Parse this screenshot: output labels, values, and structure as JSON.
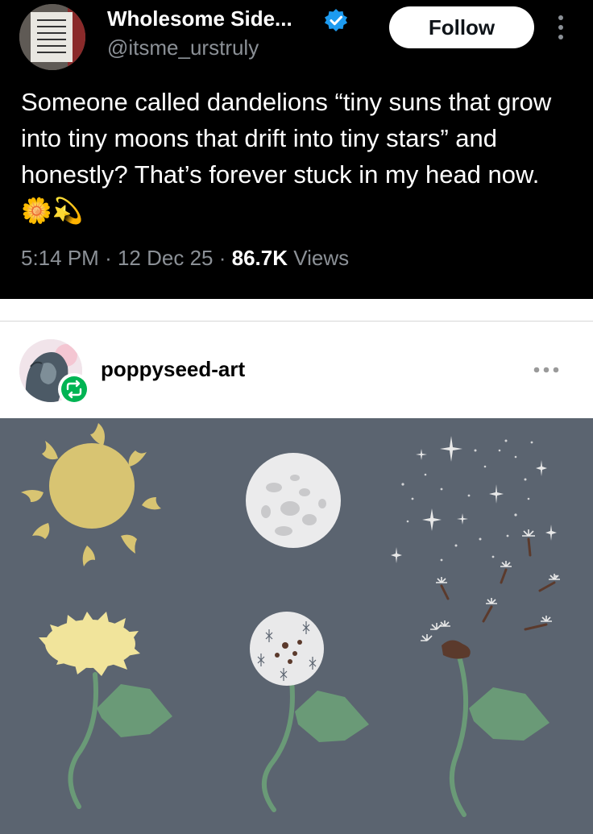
{
  "tweet": {
    "display_name": "Wholesome Side...",
    "handle": "@itsme_urstruly",
    "follow_label": "Follow",
    "text": "Someone called dandelions “tiny suns that grow into tiny moons that drift into tiny stars” and honestly? That’s forever stuck in my head now. 🌼💫",
    "time": "5:14 PM",
    "date": "12 Dec 25",
    "views_count": "86.7K",
    "views_label": "Views",
    "sep": "·"
  },
  "post": {
    "username": "poppyseed-art"
  },
  "colors": {
    "tweet_bg": "#000000",
    "verified_blue": "#1d9bf0",
    "reblog_green": "#00b453",
    "art_bg": "#5b6470",
    "sun_yellow": "#d8c472",
    "dandelion_yellow": "#f1e49b",
    "leaf_green": "#6a9a77"
  }
}
